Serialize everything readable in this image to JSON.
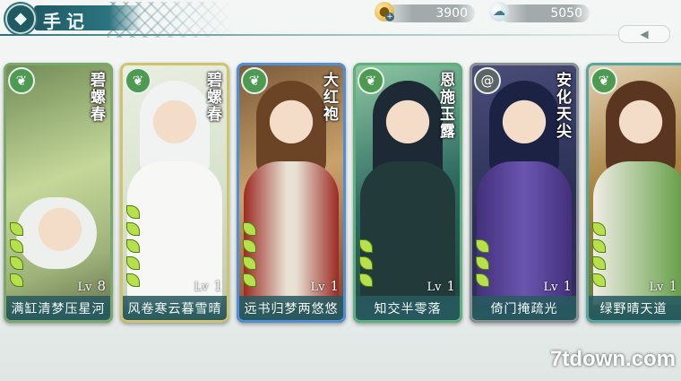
{
  "header": {
    "back_icon": "diamond-back-icon",
    "title": "手记",
    "arrow_tab_icon": "left-arrow-icon"
  },
  "currency": {
    "coins": {
      "icon": "coin-icon",
      "value": "3900"
    },
    "jade": {
      "icon": "jade-cloud-icon",
      "value": "5050"
    }
  },
  "cards": [
    {
      "badge": "leaf-icon",
      "badge_color": "#4f9a52",
      "name_vertical": "碧螺春",
      "level_prefix": "Lv",
      "level": "8",
      "caption": "满缸清梦压星河",
      "frame_color": "#7aa86a",
      "leaves": 4
    },
    {
      "badge": "leaf-icon",
      "badge_color": "#4f9a52",
      "name_vertical": "碧螺春",
      "level_prefix": "Lv",
      "level": "1",
      "caption": "风卷寒云暮雪晴",
      "frame_color": "#cfc36c",
      "leaves": 5
    },
    {
      "badge": "leaf-icon",
      "badge_color": "#4f9a52",
      "name_vertical": "大红袍",
      "level_prefix": "Lv",
      "level": "1",
      "caption": "远书归梦两悠悠",
      "frame_color": "#4f8fd8",
      "leaves": 4
    },
    {
      "badge": "leaf-icon",
      "badge_color": "#4f9a52",
      "name_vertical": "恩施玉露",
      "level_prefix": "Lv",
      "level": "1",
      "caption": "知交半零落",
      "frame_color": "#5fb07c",
      "leaves": 3
    },
    {
      "badge": "swirl-icon",
      "badge_color": "#5d6466",
      "name_vertical": "安化天尖",
      "level_prefix": "Lv",
      "level": "1",
      "caption": "倚门掩疏光",
      "frame_color": "#8a8f92",
      "leaves": 3
    },
    {
      "badge": "leaf-icon",
      "badge_color": "#4f9a52",
      "name_vertical": "",
      "level_prefix": "Lv",
      "level": "1",
      "caption": "绿野晴天道",
      "frame_color": "#57a6a0",
      "leaves": 4
    }
  ],
  "watermark": "7tdown.com"
}
